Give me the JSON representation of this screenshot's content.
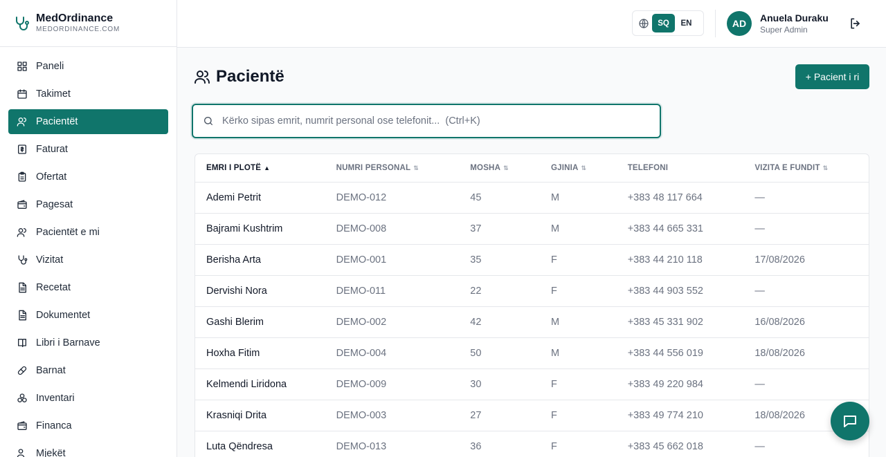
{
  "brand": {
    "name": "MedOrdinance",
    "subtitle": "MEDORDINANCE.COM"
  },
  "sidebar": {
    "items": [
      {
        "label": "Paneli",
        "icon": "dashboard-icon"
      },
      {
        "label": "Takimet",
        "icon": "calendar-icon"
      },
      {
        "label": "Pacientët",
        "icon": "users-icon",
        "active": true
      },
      {
        "label": "Faturat",
        "icon": "invoice-icon"
      },
      {
        "label": "Ofertat",
        "icon": "clipboard-icon"
      },
      {
        "label": "Pagesat",
        "icon": "wallet-icon"
      },
      {
        "label": "Pacientët e mi",
        "icon": "users-icon"
      },
      {
        "label": "Vizitat",
        "icon": "stethoscope-icon"
      },
      {
        "label": "Recetat",
        "icon": "document-icon"
      },
      {
        "label": "Dokumentet",
        "icon": "document-icon"
      },
      {
        "label": "Libri i Barnave",
        "icon": "book-icon"
      },
      {
        "label": "Barnat",
        "icon": "pill-icon"
      },
      {
        "label": "Inventari",
        "icon": "boxes-icon"
      },
      {
        "label": "Financa",
        "icon": "wallet-icon"
      },
      {
        "label": "Mjekët",
        "icon": "user-doctor-icon"
      }
    ]
  },
  "header": {
    "languages": [
      "SQ",
      "EN"
    ],
    "active_language": "SQ",
    "user": {
      "initials": "AD",
      "name": "Anuela Duraku",
      "role": "Super Admin"
    }
  },
  "page": {
    "title": "Pacientë",
    "new_button": "+ Pacient i ri",
    "search_placeholder": "Kërko sipas emrit, numrit personal ose telefonit...  (Ctrl+K)"
  },
  "table": {
    "columns": [
      {
        "label": "EMRI I PLOTË",
        "sort": "asc"
      },
      {
        "label": "NUMRI PERSONAL",
        "sort": "none"
      },
      {
        "label": "MOSHA",
        "sort": "none"
      },
      {
        "label": "GJINIA",
        "sort": "none"
      },
      {
        "label": "TELEFONI",
        "sort": null
      },
      {
        "label": "VIZITA E FUNDIT",
        "sort": "none"
      }
    ],
    "rows": [
      [
        "Ademi Petrit",
        "DEMO-012",
        "45",
        "M",
        "+383 48 117 664",
        "—"
      ],
      [
        "Bajrami Kushtrim",
        "DEMO-008",
        "37",
        "M",
        "+383 44 665 331",
        "—"
      ],
      [
        "Berisha Arta",
        "DEMO-001",
        "35",
        "F",
        "+383 44 210 118",
        "17/08/2026"
      ],
      [
        "Dervishi Nora",
        "DEMO-011",
        "22",
        "F",
        "+383 44 903 552",
        "—"
      ],
      [
        "Gashi Blerim",
        "DEMO-002",
        "42",
        "M",
        "+383 45 331 902",
        "16/08/2026"
      ],
      [
        "Hoxha Fitim",
        "DEMO-004",
        "50",
        "M",
        "+383 44 556 019",
        "18/08/2026"
      ],
      [
        "Kelmendi Liridona",
        "DEMO-009",
        "30",
        "F",
        "+383 49 220 984",
        "—"
      ],
      [
        "Krasniqi Drita",
        "DEMO-003",
        "27",
        "F",
        "+383 49 774 210",
        "18/08/2026"
      ],
      [
        "Luta Qëndresa",
        "DEMO-013",
        "36",
        "F",
        "+383 45 662 018",
        "—"
      ]
    ]
  },
  "colors": {
    "accent": "#10756b",
    "border": "#e5e7eb",
    "muted_text": "#6b7280"
  }
}
